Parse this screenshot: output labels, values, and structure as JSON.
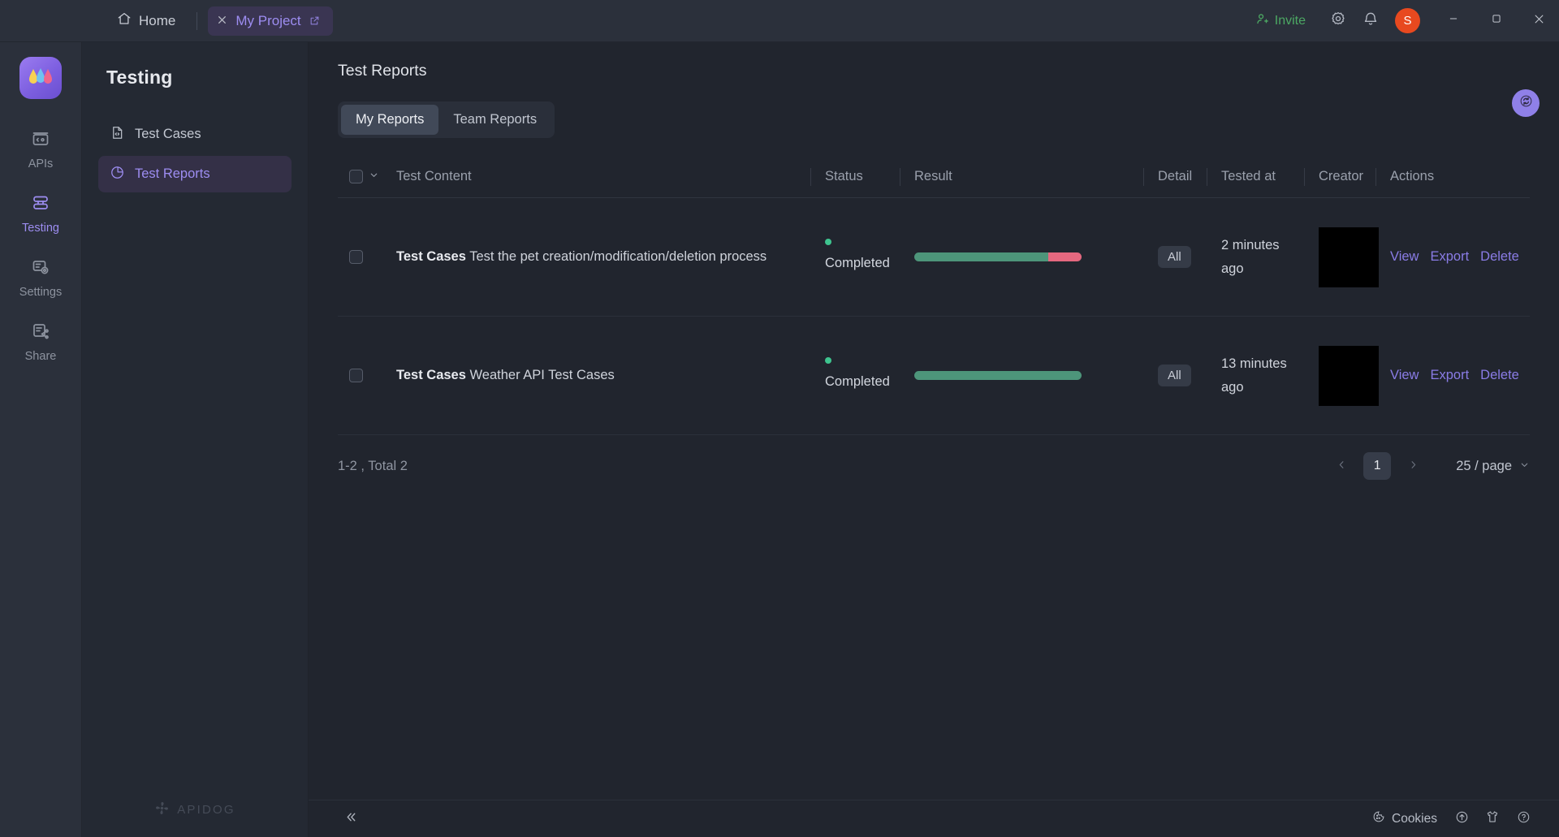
{
  "titlebar": {
    "home_label": "Home",
    "project_tab": {
      "label": "My Project",
      "close_icon": "close-icon",
      "external_icon": "external-link-icon"
    },
    "invite_label": "Invite",
    "settings_icon": "gear-icon",
    "notifications_icon": "bell-icon",
    "avatar_initial": "S",
    "avatar_color": "#e8491f",
    "window_minimize": "minimize-icon",
    "window_maximize": "maximize-icon",
    "window_close": "close-icon"
  },
  "rail": {
    "logo_name": "apidog-logo",
    "items": [
      {
        "label": "APIs",
        "icon": "apis-icon",
        "active": false
      },
      {
        "label": "Testing",
        "icon": "testing-icon",
        "active": true
      },
      {
        "label": "Settings",
        "icon": "settings-icon",
        "active": false
      },
      {
        "label": "Share",
        "icon": "share-icon",
        "active": false
      }
    ]
  },
  "sidebar": {
    "title": "Testing",
    "items": [
      {
        "label": "Test Cases",
        "icon": "file-code-icon",
        "active": false
      },
      {
        "label": "Test Reports",
        "icon": "pie-chart-icon",
        "active": true
      }
    ],
    "watermark": "APIDOG"
  },
  "main": {
    "title": "Test Reports",
    "refresh_icon": "refresh-icon",
    "tabs": [
      {
        "label": "My Reports",
        "active": true
      },
      {
        "label": "Team Reports",
        "active": false
      }
    ],
    "columns": {
      "test_content": "Test Content",
      "status": "Status",
      "result": "Result",
      "detail": "Detail",
      "tested_at": "Tested at",
      "creator": "Creator",
      "actions": "Actions"
    },
    "rows": [
      {
        "kind": "Test Cases",
        "name": "Test the pet creation/modification/deletion process",
        "status": "Completed",
        "status_color": "#3ec48f",
        "pass_percent": 80,
        "fail_percent": 20,
        "detail": "All",
        "tested_at": "2 minutes ago",
        "creator": "",
        "actions": {
          "view": "View",
          "export": "Export",
          "delete": "Delete"
        }
      },
      {
        "kind": "Test Cases",
        "name": "Weather API Test Cases",
        "status": "Completed",
        "status_color": "#3ec48f",
        "pass_percent": 100,
        "fail_percent": 0,
        "detail": "All",
        "tested_at": "13 minutes ago",
        "creator": "",
        "actions": {
          "view": "View",
          "export": "Export",
          "delete": "Delete"
        }
      }
    ],
    "pagination": {
      "summary": "1-2 , Total 2",
      "prev_icon": "chevron-left-icon",
      "next_icon": "chevron-right-icon",
      "current_page": "1",
      "page_size": "25 / page"
    }
  },
  "statusbar": {
    "collapse_icon": "double-chevron-left-icon",
    "cookies_label": "Cookies",
    "upload_icon": "upload-circle-icon",
    "tshirt_icon": "tshirt-icon",
    "help_icon": "help-circle-icon"
  },
  "colors": {
    "accent_purple": "#8a7ce6",
    "pass_green": "#4d957a",
    "fail_red": "#e5687f",
    "invite_green": "#4ca863"
  }
}
